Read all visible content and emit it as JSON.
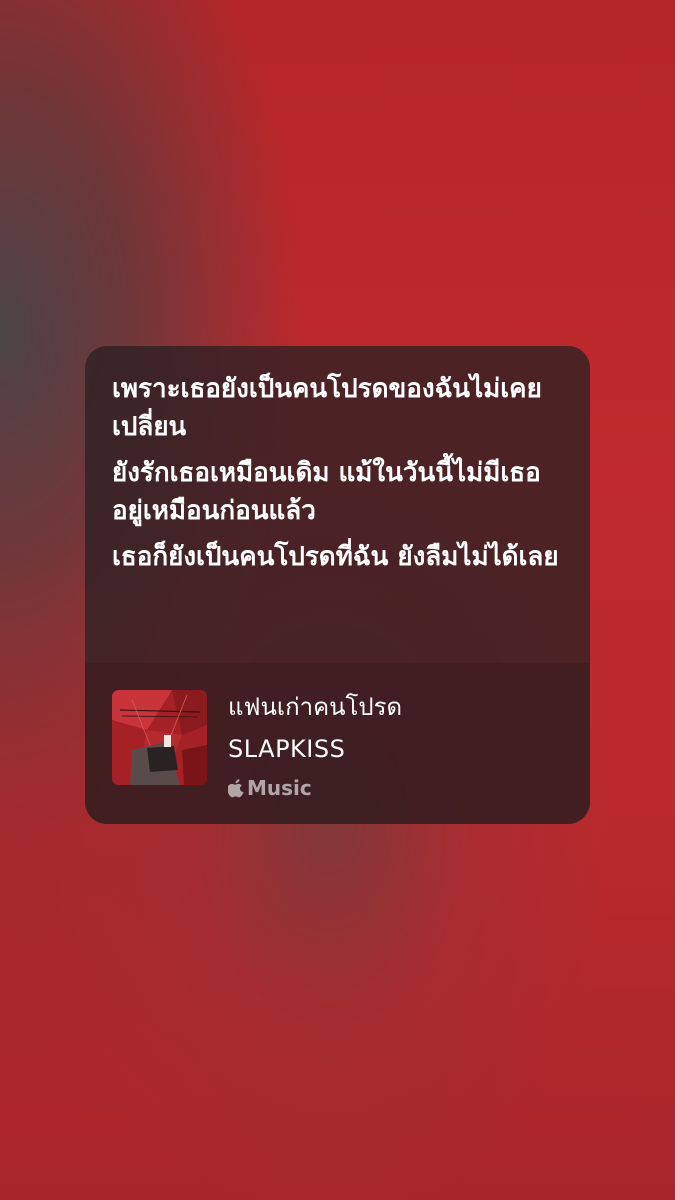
{
  "lyrics": [
    "เพราะเธอยังเป็นคนโปรดของฉันไม่เคยเปลี่ยน",
    "ยังรักเธอเหมือนเดิม แม้ในวันนี้ไม่มีเธออยู่เหมือนก่อนแล้ว",
    "เธอก็ยังเป็นคนโปรดที่ฉัน ยังลืมไม่ได้เลย"
  ],
  "track": {
    "title": "แฟนเก่าคนโปรด",
    "artist": "SLAPKISS",
    "service_label": "Music",
    "service_icon": "apple-logo-icon"
  },
  "colors": {
    "background": "#b8282c",
    "card": "#2d2022",
    "text": "#ffffff",
    "muted_text": "#bfb3b4"
  }
}
